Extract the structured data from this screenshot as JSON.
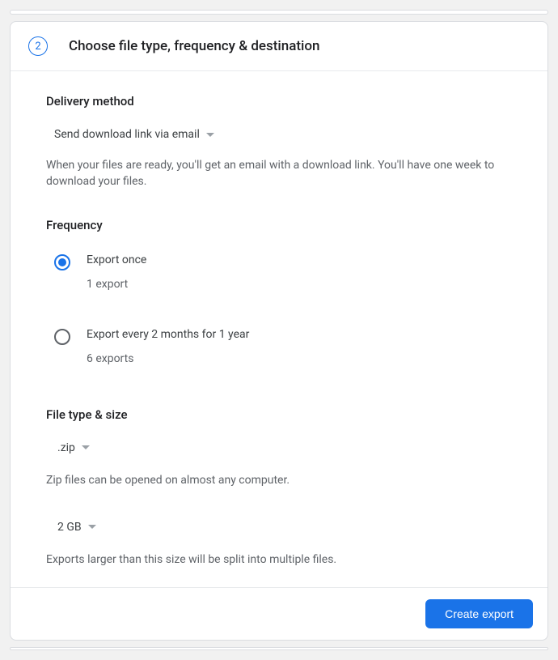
{
  "step": {
    "number": "2",
    "title": "Choose file type, frequency & destination"
  },
  "delivery": {
    "heading": "Delivery method",
    "selected": "Send download link via email",
    "helper": "When your files are ready, you'll get an email with a download link. You'll have one week to download your files."
  },
  "frequency": {
    "heading": "Frequency",
    "options": [
      {
        "label": "Export once",
        "sub": "1 export",
        "selected": true
      },
      {
        "label": "Export every 2 months for 1 year",
        "sub": "6 exports",
        "selected": false
      }
    ]
  },
  "filetype": {
    "heading": "File type & size",
    "type_selected": ".zip",
    "type_helper": "Zip files can be opened on almost any computer.",
    "size_selected": "2 GB",
    "size_helper": "Exports larger than this size will be split into multiple files."
  },
  "footer": {
    "create_label": "Create export"
  }
}
